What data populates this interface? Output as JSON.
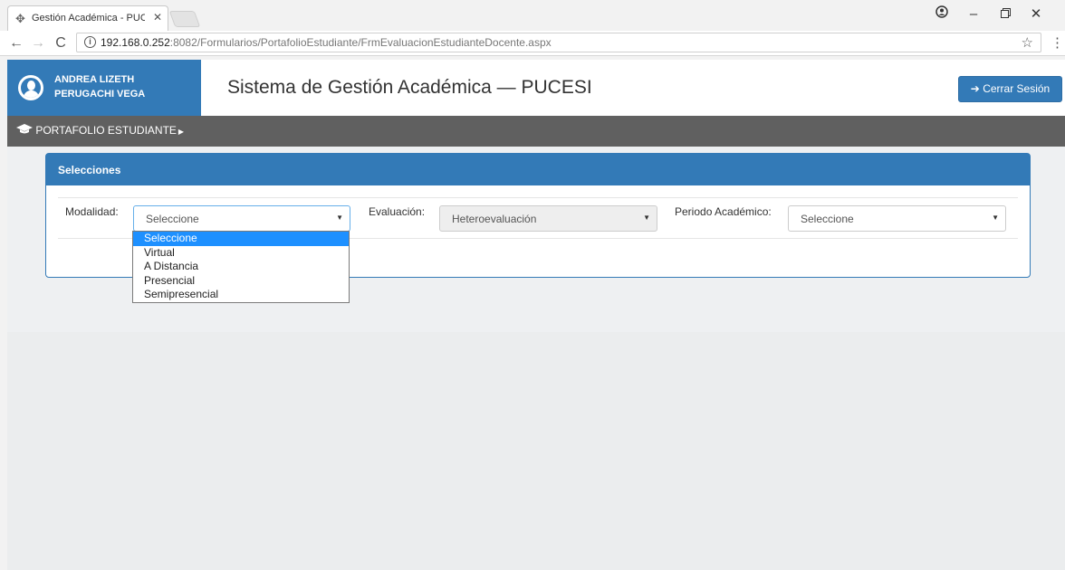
{
  "browser": {
    "tab_title": "Gestión Académica - PUC",
    "url_host": "192.168.0.252",
    "url_rest": ":8082/Formularios/PortafolioEstudiante/FrmEvaluacionEstudianteDocente.aspx",
    "icons": [
      "favicon-icon",
      "close-icon",
      "back-icon",
      "forward-icon",
      "reload-icon",
      "info-icon",
      "star-icon",
      "menu-icon",
      "profile-icon",
      "minimize-icon",
      "maximize-icon",
      "window-close-icon"
    ]
  },
  "header": {
    "user_name_line1": "ANDREA LIZETH",
    "user_name_line2": "PERUGACHI VEGA",
    "title": "Sistema de Gestión Académica — PUCESI",
    "logout_label": "Cerrar Sesión",
    "accent_color": "#337ab7"
  },
  "menu": {
    "item": "PORTAFOLIO ESTUDIANTE"
  },
  "panel": {
    "heading": "Selecciones",
    "modalidad_label": "Modalidad:",
    "modalidad_value": "Seleccione",
    "evaluacion_label": "Evaluación:",
    "evaluacion_value": "Heteroevaluación",
    "periodo_label": "Periodo Académico:",
    "periodo_value": "Seleccione"
  },
  "dropdown": {
    "options": [
      "Seleccione",
      "Virtual",
      "A Distancia",
      "Presencial",
      "Semipresencial"
    ],
    "selected": "Seleccione"
  }
}
